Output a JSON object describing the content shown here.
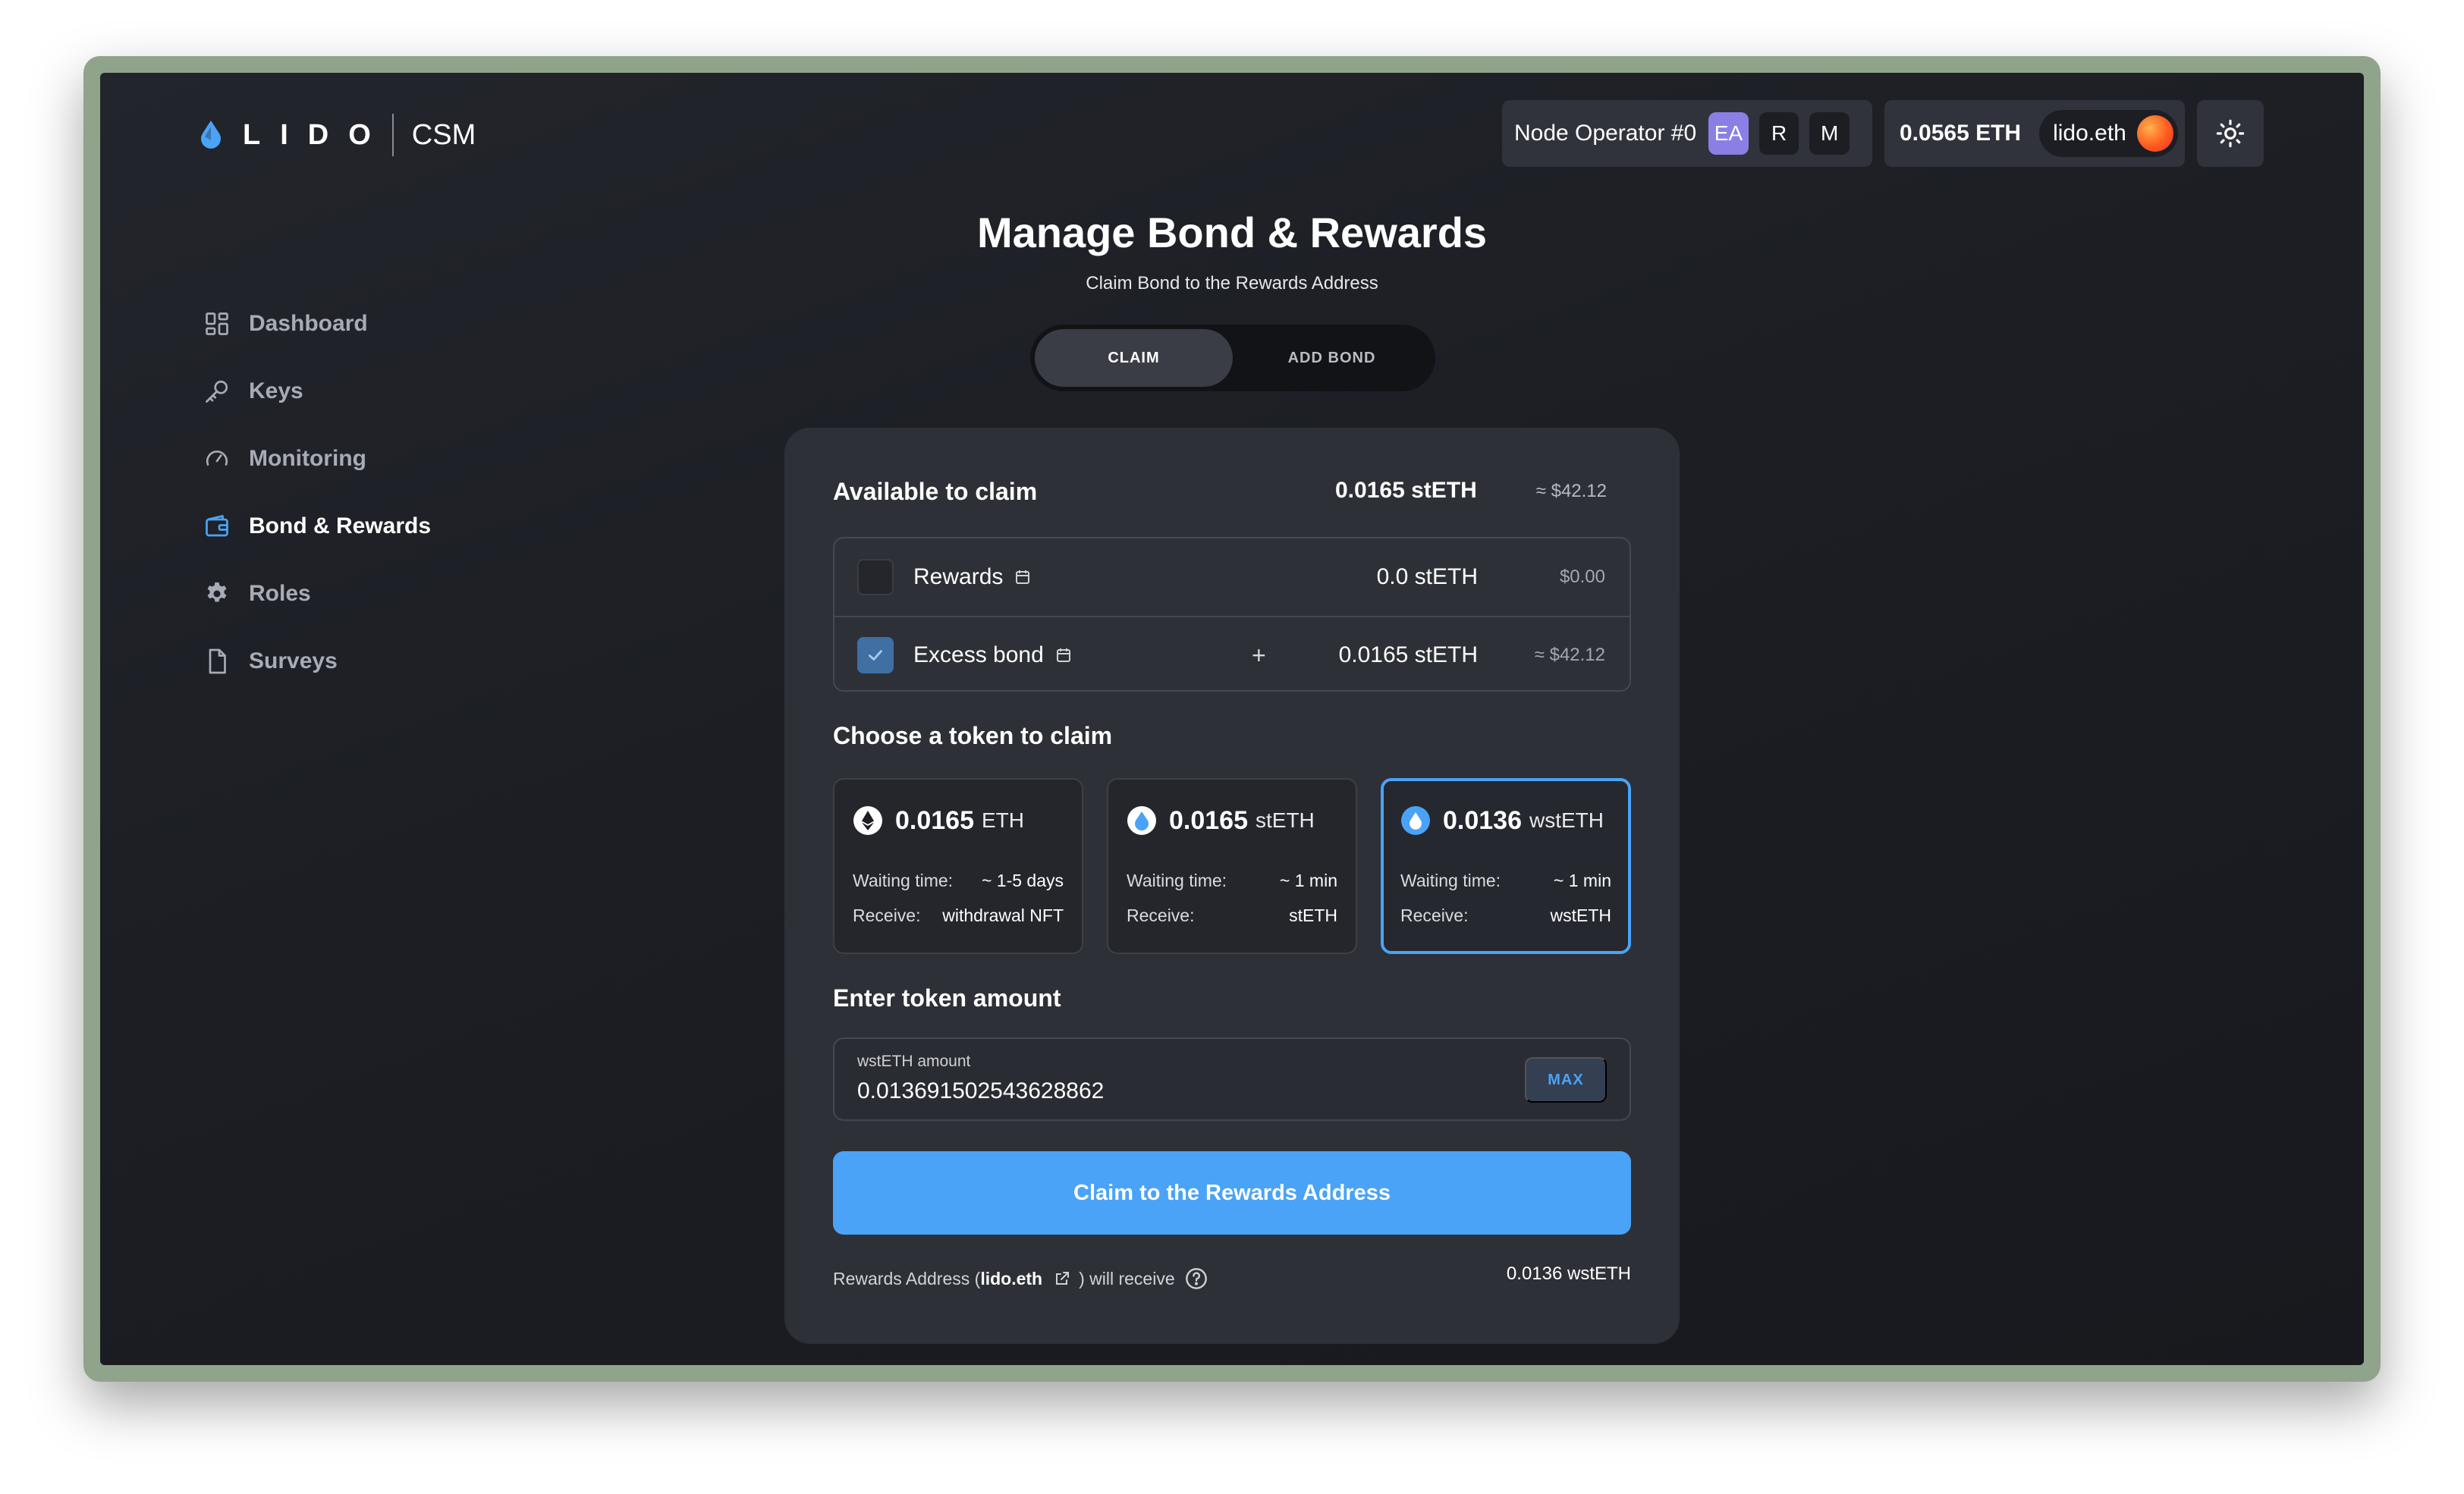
{
  "app": {
    "wordmark": "LIDO",
    "product": "CSM"
  },
  "header": {
    "operator_label": "Node Operator #0",
    "roles": [
      "EA",
      "R",
      "M"
    ],
    "balance": "0.0565 ETH",
    "ens": "lido.eth",
    "theme_icon": "sun-icon"
  },
  "sidebar": {
    "items": [
      {
        "label": "Dashboard",
        "icon": "dashboard-icon"
      },
      {
        "label": "Keys",
        "icon": "key-icon"
      },
      {
        "label": "Monitoring",
        "icon": "gauge-icon"
      },
      {
        "label": "Bond & Rewards",
        "icon": "wallet-icon",
        "active": true
      },
      {
        "label": "Roles",
        "icon": "gear-icon"
      },
      {
        "label": "Surveys",
        "icon": "document-icon"
      }
    ]
  },
  "page": {
    "title": "Manage Bond & Rewards",
    "subtitle": "Claim Bond to the Rewards Address",
    "tabs": [
      {
        "label": "CLAIM",
        "active": true
      },
      {
        "label": "ADD BOND",
        "active": false
      }
    ]
  },
  "available": {
    "title": "Available to claim",
    "amount": "0.0165 stETH",
    "usd": "≈ $42.12",
    "rows": [
      {
        "label": "Rewards",
        "checked": false,
        "prefix": "",
        "amount": "0.0 stETH",
        "usd": "$0.00"
      },
      {
        "label": "Excess bond",
        "checked": true,
        "prefix": "+",
        "amount": "0.0165 stETH",
        "usd": "≈ $42.12"
      }
    ]
  },
  "tokens": {
    "title": "Choose a token to claim",
    "waiting_label": "Waiting time:",
    "receive_label": "Receive:",
    "options": [
      {
        "amount": "0.0165",
        "symbol": "ETH",
        "waiting": "~ 1-5 days",
        "receive": "withdrawal NFT",
        "selected": false
      },
      {
        "amount": "0.0165",
        "symbol": "stETH",
        "waiting": "~ 1 min",
        "receive": "stETH",
        "selected": false
      },
      {
        "amount": "0.0136",
        "symbol": "wstETH",
        "waiting": "~ 1 min",
        "receive": "wstETH",
        "selected": true
      }
    ]
  },
  "amount_input": {
    "title": "Enter token amount",
    "label": "wstETH amount",
    "value": "0.013691502543628862",
    "max_label": "MAX"
  },
  "claim_button": "Claim to the Rewards Address",
  "footer": {
    "prefix": "Rewards Address (",
    "address": "lido.eth",
    "suffix": ") will receive",
    "amount": "0.0136 wstETH"
  },
  "colors": {
    "accent": "#4aa3f7",
    "role_active": "#8b7fe6",
    "card": "#2e3037"
  }
}
